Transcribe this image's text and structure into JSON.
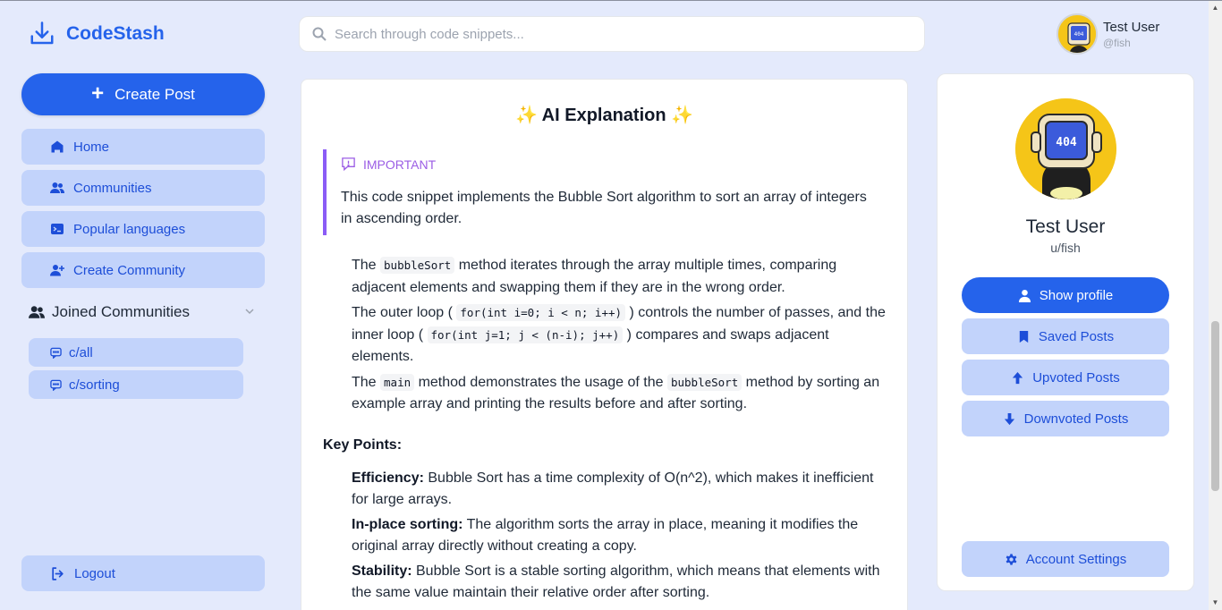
{
  "app": {
    "name": "CodeStash"
  },
  "sidebar": {
    "create_label": "Create Post",
    "items": [
      {
        "label": "Home",
        "icon": "home-icon"
      },
      {
        "label": "Communities",
        "icon": "users-icon"
      },
      {
        "label": "Popular languages",
        "icon": "terminal-icon"
      },
      {
        "label": "Create Community",
        "icon": "user-plus-icon"
      }
    ],
    "joined_label": "Joined Communities",
    "communities": [
      "c/all",
      "c/sorting"
    ],
    "logout_label": "Logout"
  },
  "search": {
    "placeholder": "Search through code snippets..."
  },
  "user": {
    "name": "Test User",
    "handle": "@fish",
    "profile_handle": "u/fish",
    "avatar_text": "404"
  },
  "content": {
    "title": "✨ AI Explanation ✨",
    "callout_label": "IMPORTANT",
    "callout_text": "This code snippet implements the Bubble Sort algorithm to sort an array of integers in ascending order.",
    "bullets": [
      {
        "pre": "The ",
        "code": "bubbleSort",
        "post": " method iterates through the array multiple times, comparing adjacent elements and swapping them if they are in the wrong order."
      },
      {
        "pre": "The outer loop ( ",
        "code": "for(int i=0; i < n; i++)",
        "mid": " ) controls the number of passes, and the inner loop ( ",
        "code2": "for(int j=1; j < (n-i); j++)",
        "post": " ) compares and swaps adjacent elements."
      },
      {
        "pre": "The ",
        "code": "main",
        "mid": " method demonstrates the usage of the ",
        "code2": "bubbleSort",
        "post": " method by sorting an example array and printing the results before and after sorting."
      }
    ],
    "key_points_heading": "Key Points:",
    "key_points": [
      {
        "term": "Efficiency:",
        "text": " Bubble Sort has a time complexity of O(n^2), which makes it inefficient for large arrays."
      },
      {
        "term": "In-place sorting:",
        "text": " The algorithm sorts the array in place, meaning it modifies the original array directly without creating a copy."
      },
      {
        "term": "Stability:",
        "text": " Bubble Sort is a stable sorting algorithm, which means that elements with the same value maintain their relative order after sorting."
      }
    ]
  },
  "profile": {
    "buttons": [
      {
        "label": "Show profile",
        "icon": "user-icon"
      },
      {
        "label": "Saved Posts",
        "icon": "bookmark-icon"
      },
      {
        "label": "Upvoted Posts",
        "icon": "arrow-up-icon"
      },
      {
        "label": "Downvoted Posts",
        "icon": "arrow-down-icon"
      }
    ],
    "settings_label": "Account Settings"
  },
  "colors": {
    "accent": "#2563eb",
    "nav_bg": "#c2d3fb",
    "page_bg": "#e4eafc",
    "callout": "#8b5cf6"
  }
}
